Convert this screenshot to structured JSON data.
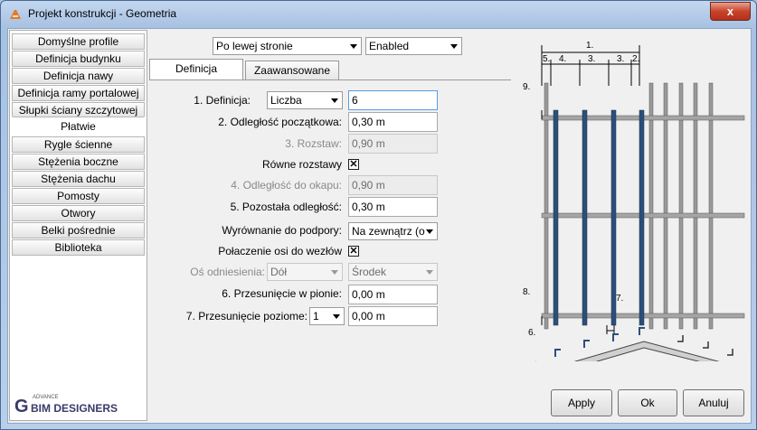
{
  "window": {
    "title": "Projekt konstrukcji - Geometria",
    "close_glyph": "x"
  },
  "sidebar": {
    "items": [
      {
        "label": "Domyślne profile"
      },
      {
        "label": "Definicja budynku"
      },
      {
        "label": "Definicja nawy"
      },
      {
        "label": "Definicja ramy portalowej"
      },
      {
        "label": "Słupki ściany szczytowej"
      },
      {
        "label": "Płatwie"
      },
      {
        "label": "Rygle ścienne"
      },
      {
        "label": "Stężenia boczne"
      },
      {
        "label": "Stężenia dachu"
      },
      {
        "label": "Pomosty"
      },
      {
        "label": "Otwory"
      },
      {
        "label": "Belki pośrednie"
      },
      {
        "label": "Biblioteka"
      }
    ],
    "active": "Płatwie"
  },
  "top": {
    "side_select": "Po lewej stronie",
    "state_select": "Enabled"
  },
  "tabs": [
    {
      "label": "Definicja"
    },
    {
      "label": "Zaawansowane"
    }
  ],
  "form": {
    "definicja": {
      "label": "1. Definicja:",
      "mode": "Liczba",
      "value": "6"
    },
    "odl_poczatkowa": {
      "label": "2. Odległość początkowa:",
      "value": "0,30 m"
    },
    "rozstaw": {
      "label": "3. Rozstaw:",
      "value": "0,90 m"
    },
    "rowne_rozstawy": {
      "label": "Równe rozstawy",
      "checked": "✕"
    },
    "odl_okapu": {
      "label": "4. Odległość do okapu:",
      "value": "0,90 m"
    },
    "pozostala": {
      "label": "5. Pozostała odległość:",
      "value": "0,30 m"
    },
    "wyrownanie": {
      "label": "Wyrównanie do podpory:",
      "value": "Na zewnątrz (o"
    },
    "polaczenie": {
      "label": "Połaczenie osi do wezłów",
      "checked": "✕"
    },
    "os_odniesienia": {
      "label": "Oś odniesienia:",
      "value1": "Dół",
      "value2": "Środek"
    },
    "przes_pion": {
      "label": "6. Przesunięcie w pionie:",
      "value": "0,00 m"
    },
    "przes_poziom": {
      "label": "7. Przesunięcie poziome:",
      "select": "1",
      "value": "0,00 m"
    }
  },
  "diagram": {
    "labels": [
      "1.",
      "5.",
      "4.",
      "3.",
      "3.",
      "2.",
      "9.",
      "8.",
      "7.",
      "6."
    ]
  },
  "footer": {
    "apply": "Apply",
    "ok": "Ok",
    "cancel": "Anuluj",
    "logo_small": "ADVANCE",
    "logo_text": "BIM DESIGNERS",
    "logo_letter": "G"
  }
}
